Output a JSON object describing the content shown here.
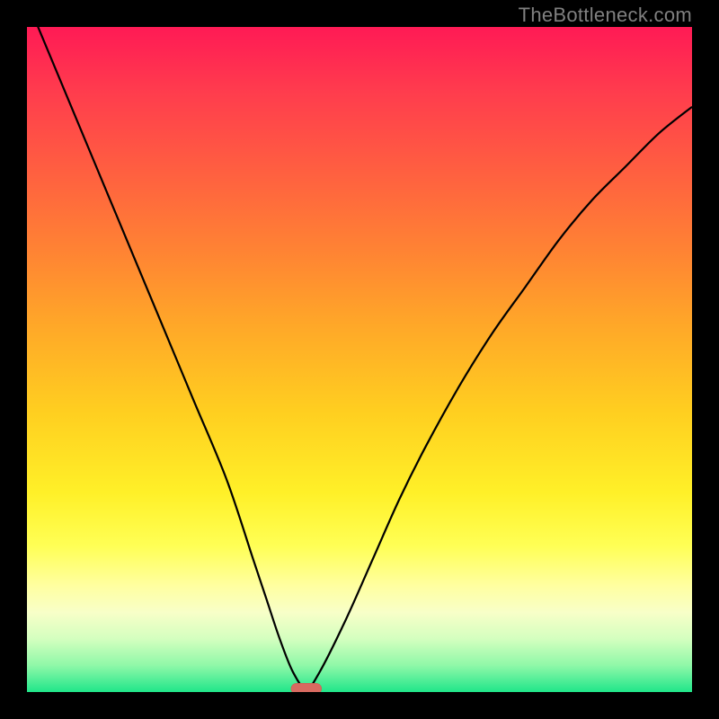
{
  "watermark": "TheBottleneck.com",
  "chart_data": {
    "type": "line",
    "title": "",
    "xlabel": "",
    "ylabel": "",
    "xlim": [
      0,
      100
    ],
    "ylim": [
      0,
      100
    ],
    "x": [
      0,
      5,
      10,
      15,
      20,
      25,
      30,
      34,
      36,
      38,
      40,
      42,
      44,
      48,
      52,
      56,
      60,
      65,
      70,
      75,
      80,
      85,
      90,
      95,
      100
    ],
    "values": [
      104,
      92,
      80,
      68,
      56,
      44,
      32,
      20,
      14,
      8,
      3,
      0.5,
      3,
      11,
      20,
      29,
      37,
      46,
      54,
      61,
      68,
      74,
      79,
      84,
      88
    ],
    "marker": {
      "x": 42,
      "y": 0.5,
      "color": "#d96a60"
    },
    "background_gradient": [
      "#ff1a55",
      "#ffcf20",
      "#ffff55",
      "#20e68a"
    ]
  }
}
